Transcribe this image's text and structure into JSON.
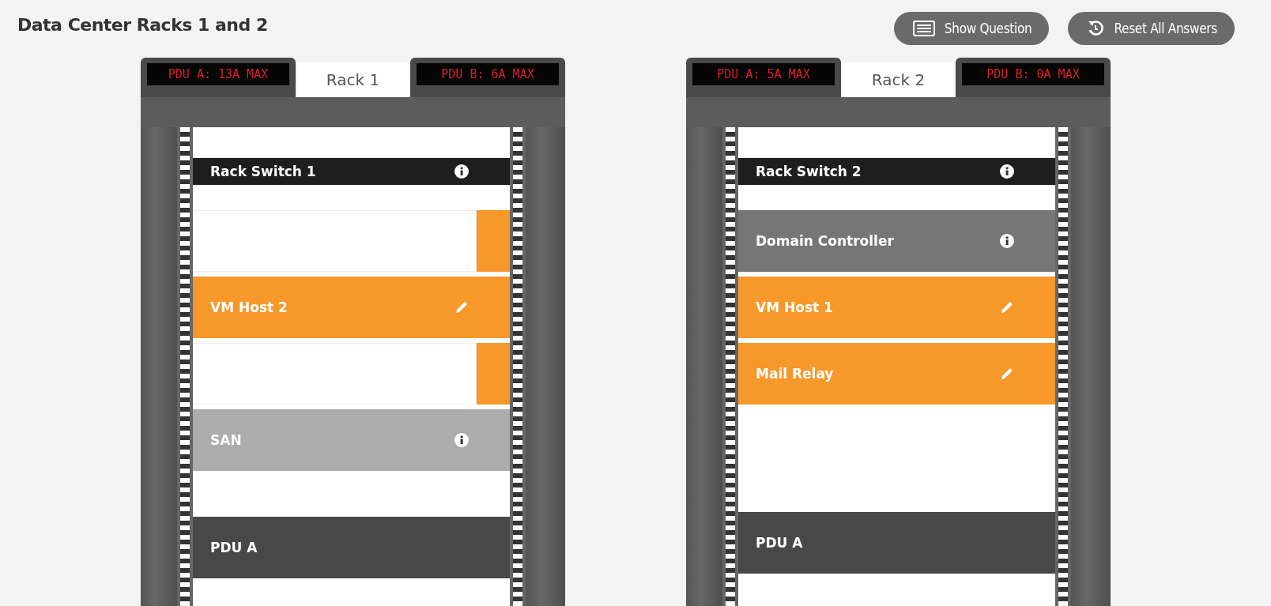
{
  "title": "Data Center Racks 1 and 2",
  "buttons": [
    {
      "kind": "question",
      "label": "Show Question"
    },
    {
      "kind": "reset",
      "label": "Reset All Answers"
    }
  ],
  "racks": [
    {
      "label": "Rack 1",
      "pdu_a": "PDU A: 13A MAX",
      "pdu_b": "PDU B: 6A MAX",
      "slots": [
        {
          "kind": "empty"
        },
        {
          "kind": "switch",
          "label": "Rack Switch 1",
          "color": "#1e1e1e"
        },
        {
          "kind": "empty"
        },
        {
          "kind": "placeholder"
        },
        {
          "kind": "vm",
          "label": "VM Host 2",
          "color": "#f7982a"
        },
        {
          "kind": "placeholder"
        },
        {
          "kind": "server",
          "label": "SAN",
          "color": "#acacac"
        },
        {
          "kind": "empty"
        },
        {
          "kind": "empty"
        },
        {
          "kind": "pdu",
          "label": "PDU A",
          "color": "#484848"
        },
        {
          "kind": "empty"
        }
      ]
    },
    {
      "label": "Rack 2",
      "pdu_a": "PDU A: 5A MAX",
      "pdu_b": "PDU B: 0A MAX",
      "slots": [
        {
          "kind": "empty"
        },
        {
          "kind": "switch",
          "label": "Rack Switch 2",
          "color": "#1e1e1e"
        },
        {
          "kind": "empty"
        },
        {
          "kind": "server",
          "label": "Domain Controller",
          "color": "#767676"
        },
        {
          "kind": "vm",
          "label": "VM Host 1",
          "color": "#f7982a"
        },
        {
          "kind": "vm",
          "label": "Mail Relay",
          "color": "#f7982a"
        },
        {
          "kind": "empty"
        },
        {
          "kind": "empty"
        },
        {
          "kind": "empty"
        },
        {
          "kind": "empty"
        },
        {
          "kind": "empty"
        },
        {
          "kind": "pdu",
          "label": "PDU A",
          "color": "#484848"
        },
        {
          "kind": "empty"
        }
      ]
    }
  ]
}
